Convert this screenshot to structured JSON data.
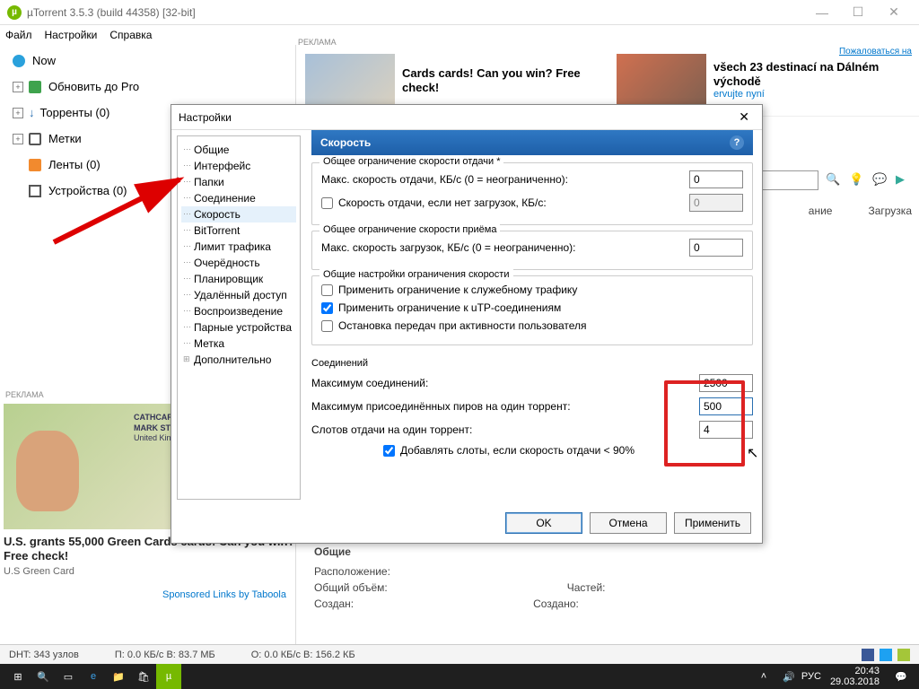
{
  "window": {
    "title": "µTorrent 3.5.3  (build 44358) [32-bit]"
  },
  "menubar": {
    "file": "Файл",
    "settings": "Настройки",
    "help": "Справка"
  },
  "sidebar": {
    "now": "Now",
    "upgrade": "Обновить до Pro",
    "torrents": "Торренты (0)",
    "labels": "Метки",
    "feeds": "Ленты (0)",
    "devices": "Устройства (0)"
  },
  "ads": {
    "label": "РЕКЛАМА",
    "report": "Пожаловаться на",
    "slot1": "Cards cards! Can you win? Free check!",
    "slot2": "všech 23 destinací na Dálném východě",
    "slot2sub": "ervujte nyní",
    "sideAdTitle": "U.S. grants 55,000 Green Cards cards! Can you win? Free check!",
    "sideAdSub": "U.S Green Card",
    "sponsor": "Sponsored Links by Taboola"
  },
  "toolbar": {
    "tabStatus": "ание",
    "tabDownload": "Загрузка"
  },
  "general": {
    "title": "Общие",
    "location": "Расположение:",
    "totalSize": "Общий объём:",
    "created": "Создан:",
    "parts": "Частей:",
    "createdBy": "Создано:"
  },
  "statusbar": {
    "dht": "DHT: 343 узлов",
    "down": "П: 0.0 КБ/с В: 83.7 МБ",
    "up": "О: 0.0 КБ/с В: 156.2 КБ"
  },
  "taskbar": {
    "lang": "РУС",
    "time": "20:43",
    "date": "29.03.2018"
  },
  "dialog": {
    "title": "Настройки",
    "nav": {
      "general": "Общие",
      "interface": "Интерфейс",
      "folders": "Папки",
      "connection": "Соединение",
      "speed": "Скорость",
      "bittorrent": "BitTorrent",
      "traffic": "Лимит трафика",
      "queue": "Очерёдность",
      "scheduler": "Планировщик",
      "remote": "Удалённый доступ",
      "playback": "Воспроизведение",
      "paired": "Парные устройства",
      "label": "Метка",
      "advanced": "Дополнительно"
    },
    "paneTitle": "Скорость",
    "upload": {
      "group": "Общее ограничение скорости отдачи *",
      "maxUp": "Макс. скорость отдачи, КБ/с (0 = неограниченно):",
      "maxUpVal": "0",
      "altUp": "Скорость отдачи, если нет загрузок, КБ/с:",
      "altUpVal": "0"
    },
    "download": {
      "group": "Общее ограничение скорости приёма",
      "maxDown": "Макс. скорость загрузок, КБ/с (0 = неограниченно):",
      "maxDownVal": "0"
    },
    "limits": {
      "group": "Общие настройки ограничения скорости",
      "service": "Применить ограничение к служебному трафику",
      "utp": "Применить ограничение к uTP-соединениям",
      "stop": "Остановка передач при активности пользователя"
    },
    "conn": {
      "group": "Соединений",
      "maxConn": "Максимум соединений:",
      "maxConnVal": "2500",
      "maxPeers": "Максимум присоединённых пиров на один торрент:",
      "maxPeersVal": "500",
      "slots": "Слотов отдачи на один торрент:",
      "slotsVal": "4",
      "addSlots": "Добавлять слоты, если скорость отдачи < 90%"
    },
    "buttons": {
      "ok": "OK",
      "cancel": "Отмена",
      "apply": "Применить"
    }
  }
}
